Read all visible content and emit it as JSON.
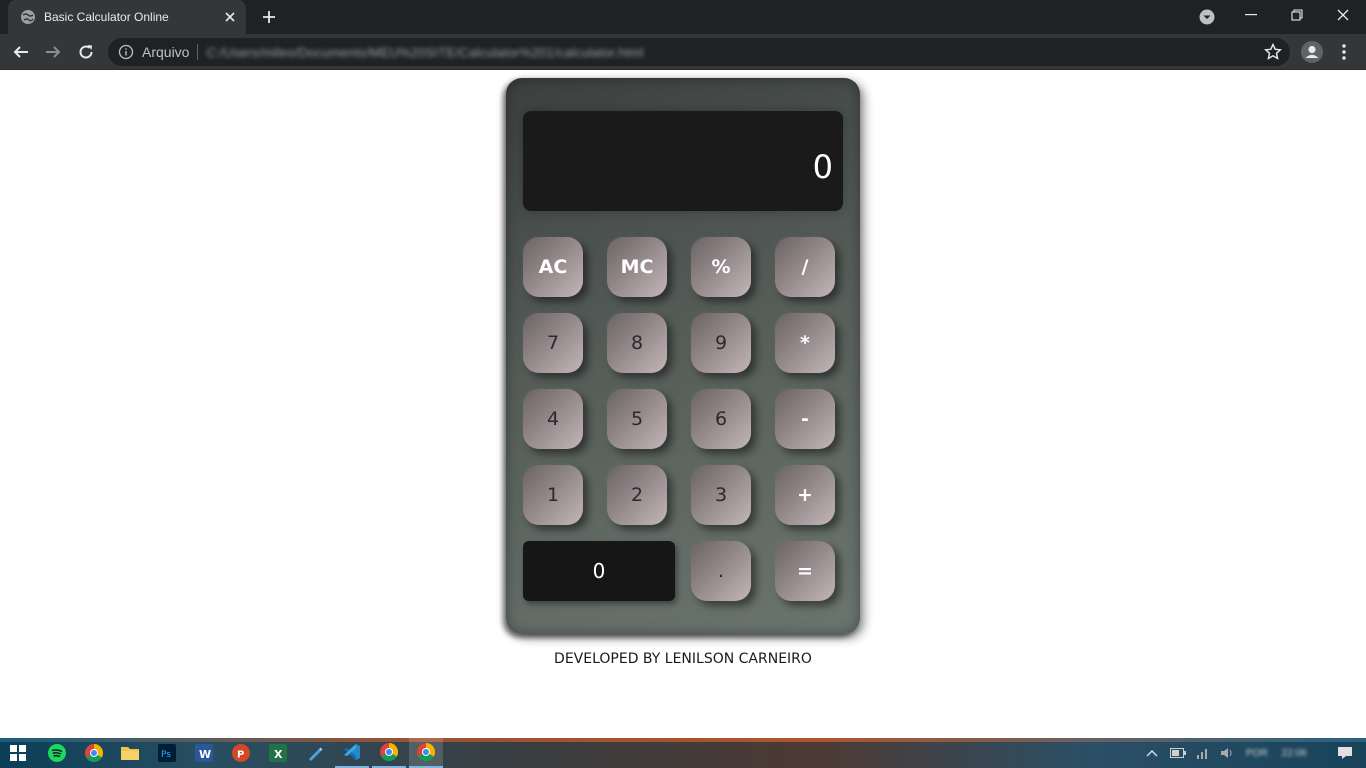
{
  "browser": {
    "tab_title": "Basic Calculator Online",
    "site_label": "Arquivo",
    "url": "C:/Users/mileo/Documents/MEU%20SITE/Calculator%201/calculator.html"
  },
  "calculator": {
    "display_value": "0",
    "rows": [
      [
        {
          "label": "AC",
          "kind": "op"
        },
        {
          "label": "MC",
          "kind": "op"
        },
        {
          "label": "%",
          "kind": "op"
        },
        {
          "label": "/",
          "kind": "op"
        }
      ],
      [
        {
          "label": "7",
          "kind": "num"
        },
        {
          "label": "8",
          "kind": "num"
        },
        {
          "label": "9",
          "kind": "num"
        },
        {
          "label": "*",
          "kind": "op"
        }
      ],
      [
        {
          "label": "4",
          "kind": "num"
        },
        {
          "label": "5",
          "kind": "num"
        },
        {
          "label": "6",
          "kind": "num"
        },
        {
          "label": "-",
          "kind": "op"
        }
      ],
      [
        {
          "label": "1",
          "kind": "num"
        },
        {
          "label": "2",
          "kind": "num"
        },
        {
          "label": "3",
          "kind": "num"
        },
        {
          "label": "+",
          "kind": "op"
        }
      ],
      [
        {
          "label": "0",
          "kind": "zero"
        },
        {
          "label": ".",
          "kind": "num"
        },
        {
          "label": "=",
          "kind": "op"
        }
      ]
    ]
  },
  "credit": "DEVELOPED BY LENILSON CARNEIRO",
  "taskbar": {
    "apps": [
      "windows-start-icon",
      "spotify-icon",
      "chrome-icon",
      "file-explorer-icon",
      "photoshop-icon",
      "word-icon",
      "powerpoint-icon",
      "excel-icon",
      "pen-icon",
      "vscode-icon",
      "chrome-icon",
      "chrome-icon"
    ],
    "tray_language": "POR",
    "tray_time": "22:06"
  },
  "colors": {
    "chrome_dark": "#202124",
    "chrome_toolbar": "#35363a",
    "calc_body": "#555c58",
    "display_bg": "#1b1a1b",
    "key_gradient_end": "#c3b6b8",
    "zero_key": "#161616"
  }
}
